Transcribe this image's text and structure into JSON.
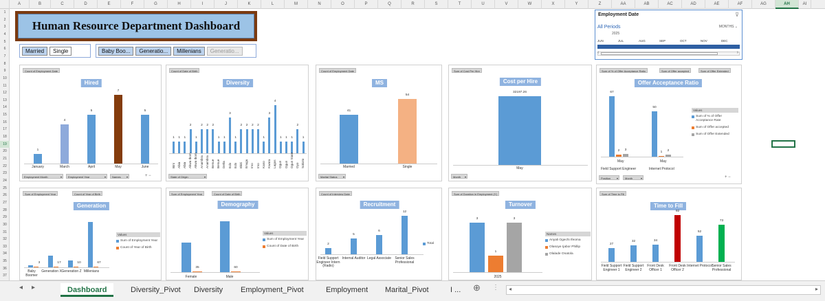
{
  "columns": [
    "A",
    "B",
    "C",
    "D",
    "E",
    "F",
    "G",
    "H",
    "I",
    "J",
    "K",
    "L",
    "M",
    "N",
    "O",
    "P",
    "Q",
    "R",
    "S",
    "T",
    "U",
    "V",
    "W",
    "X",
    "Y",
    "Z",
    "AA",
    "AB",
    "AC",
    "AD",
    "AE",
    "AF",
    "AG",
    "AH",
    "AI"
  ],
  "selected_column": "AH",
  "rows": [
    "1",
    "2",
    "3",
    "4",
    "5",
    "6",
    "7",
    "8",
    "9",
    "10",
    "11",
    "12",
    "13",
    "14",
    "15",
    "16",
    "17",
    "18",
    "19",
    "20",
    "21",
    "22",
    "23",
    "24",
    "25",
    "26",
    "27",
    "28",
    "29",
    "30",
    "31",
    "32",
    "33",
    "34",
    "35",
    "36",
    "37"
  ],
  "selected_row": "19",
  "dashboard_title": "Human Resource Department Dashboard",
  "slicers": {
    "marital": [
      {
        "label": "Married",
        "state": "on"
      },
      {
        "label": "Single",
        "state": "off"
      }
    ],
    "generation": [
      {
        "label": "Baby Boo...",
        "state": "on"
      },
      {
        "label": "Generatio...",
        "state": "on"
      },
      {
        "label": "Millenians",
        "state": "on"
      },
      {
        "label": "Generatio...",
        "state": "dim"
      }
    ]
  },
  "timeline": {
    "title": "Employment Date",
    "all_periods": "All Periods",
    "granularity": "MONTHS",
    "year": "2025",
    "months": [
      "JUN",
      "JUL",
      "AUG",
      "SEP",
      "OCT",
      "NOV",
      "DEC"
    ],
    "scroll_left": "‹",
    "scroll_right": "›"
  },
  "colors": {
    "blue": "#5b9bd5",
    "lightblue": "#8eaadb",
    "brown": "#843c0c",
    "orange": "#ed7d31",
    "salmon": "#f4b183",
    "grey": "#a5a5a5",
    "red": "#c00000",
    "green": "#00b050"
  },
  "panels": {
    "hired": {
      "chip": "Count of Employment Date",
      "title": "Hired",
      "filters": [
        "Employment Month",
        "Employment Year",
        "Names"
      ]
    },
    "diversity": {
      "chip": "Count of Date of Birth",
      "title": "Diversity",
      "filters": [
        "State of Origin"
      ]
    },
    "ms": {
      "chip": "Count of Employment Date",
      "title": "MS",
      "filters": [
        "Marital Status"
      ]
    },
    "cph": {
      "chip": "Sum of Cost Per Hire",
      "title": "Cost per Hire",
      "filters": [
        "Month"
      ]
    },
    "oar": {
      "chips": [
        "Sum of % of Offer Acceptance Ratio",
        "Sum of Offer accepted",
        "Sum of Offer Extended"
      ],
      "title": "Offer Acceptance Ratio",
      "filters": [
        "Position",
        "Month"
      ],
      "legend_title": "Values",
      "legend": [
        "Sum of % of Offer Acceptance Rate",
        "Sum of Offer accepted",
        "Sum of Offer Extended"
      ]
    },
    "generation": {
      "chips": [
        "Sum of Employment Year",
        "Count of Year of Birth"
      ],
      "title": "Generation",
      "legend_title": "Values",
      "legend": [
        "Sum of Employment Year",
        "Count of Year of Birth"
      ]
    },
    "demography": {
      "chips": [
        "Sum of Employment Year",
        "Count of Date of Birth"
      ],
      "title": "Demography",
      "legend_title": "Values",
      "legend": [
        "Sum of Employment Year",
        "Count of Date of Birth"
      ]
    },
    "recruitment": {
      "chip": "Count of Interview Date",
      "title": "Recruitment",
      "legend": [
        "Total"
      ]
    },
    "turnover": {
      "chip": "Sum of Duration in Employment (Y)",
      "title": "Turnover",
      "legend_title": "Names",
      "legend": [
        "Anyali Ogechi Ifeoma",
        "Olasoye Ijabor Phillip",
        "Olalade Onatola"
      ]
    },
    "ttf": {
      "chip": "Sum of Time to Fill",
      "title": "Time to Fill"
    }
  },
  "chart_data": [
    {
      "type": "bar",
      "title": "Hired",
      "categories": [
        "January",
        "March",
        "April",
        "May",
        "June"
      ],
      "values": [
        1,
        4,
        5,
        7,
        5
      ]
    },
    {
      "type": "bar",
      "title": "Diversity",
      "categories": [
        "Bini",
        "Abia",
        "Abia",
        "Akwa Ibom",
        "Akwa Ibom",
        "Anambra",
        "Anambra",
        "Benue",
        "Benue",
        "Delta",
        "Edo",
        "Edo",
        "Ekiti",
        "Enugu",
        "Imo",
        "Imo",
        "Kano",
        "Kwara",
        "Lagos",
        "Ogun",
        "Ogun",
        "Ogun State",
        "Oyo",
        "Sokoto"
      ],
      "values": [
        1,
        1,
        1,
        2,
        1,
        2,
        2,
        2,
        1,
        1,
        3,
        1,
        2,
        2,
        2,
        2,
        1,
        3,
        4,
        1,
        1,
        1,
        2,
        1
      ],
      "ylim": [
        0,
        4
      ]
    },
    {
      "type": "bar",
      "title": "MS",
      "categories": [
        "Married",
        "Single"
      ],
      "values": [
        41,
        54
      ]
    },
    {
      "type": "bar",
      "title": "Cost per Hire",
      "categories": [
        "May"
      ],
      "values": [
        32197.26
      ]
    },
    {
      "type": "bar",
      "title": "Offer Acceptance Ratio",
      "categories": [
        "Field Support Engineer · May",
        "Internet Protocol · May"
      ],
      "series": [
        {
          "name": "Sum of % of Offer Acceptance Rate",
          "values": [
            67,
            50
          ]
        },
        {
          "name": "Sum of Offer accepted",
          "values": [
            2,
            1
          ]
        },
        {
          "name": "Sum of Offer Extended",
          "values": [
            3,
            2
          ]
        }
      ]
    },
    {
      "type": "bar",
      "title": "Generation",
      "categories": [
        "Baby Boomer",
        "Generation X",
        "Generation Z",
        "Millenians"
      ],
      "series": [
        {
          "name": "Sum of Employment Year",
          "values": [
            3,
            17,
            10,
            67
          ]
        },
        {
          "name": "Count of Year of Birth",
          "values": [
            3,
            17,
            10,
            67
          ]
        }
      ]
    },
    {
      "type": "bar",
      "title": "Demography",
      "categories": [
        "Female",
        "Male"
      ],
      "series": [
        {
          "name": "Sum of Employment Year",
          "values": [
            35,
            60
          ]
        },
        {
          "name": "Count of Date of Birth",
          "values": [
            35,
            60
          ]
        }
      ]
    },
    {
      "type": "bar",
      "title": "Recruitment",
      "categories": [
        "Field Support Engineer Intern (Radio)",
        "Internal Auditor",
        "Legal Associate",
        "Senior Sales Professional"
      ],
      "values": [
        2,
        5,
        6,
        12
      ]
    },
    {
      "type": "bar",
      "title": "Turnover",
      "categories": [
        "2025"
      ],
      "series": [
        {
          "name": "Anyali Ogechi Ifeoma",
          "values": [
            3
          ]
        },
        {
          "name": "Olasoye Ijabor Phillip",
          "values": [
            1
          ]
        },
        {
          "name": "Olalade Onatola",
          "values": [
            3
          ]
        }
      ]
    },
    {
      "type": "bar",
      "title": "Time to Fill",
      "categories": [
        "Field Support Engineer 1",
        "Field Support Engineer 2",
        "Front Desk Officer 1",
        "Front Desk Officer 2",
        "Internet Protocol",
        "Senior Sales Professional"
      ],
      "values": [
        27,
        32,
        34,
        92,
        52,
        73
      ]
    }
  ],
  "sheet_tabs": [
    "Dashboard",
    "Diversity_Pivot",
    "Diversity",
    "Employment_Pivot",
    "Employment",
    "Marital_Pivot",
    "I ..."
  ],
  "active_tab": "Dashboard",
  "add_sheet": "⊕"
}
